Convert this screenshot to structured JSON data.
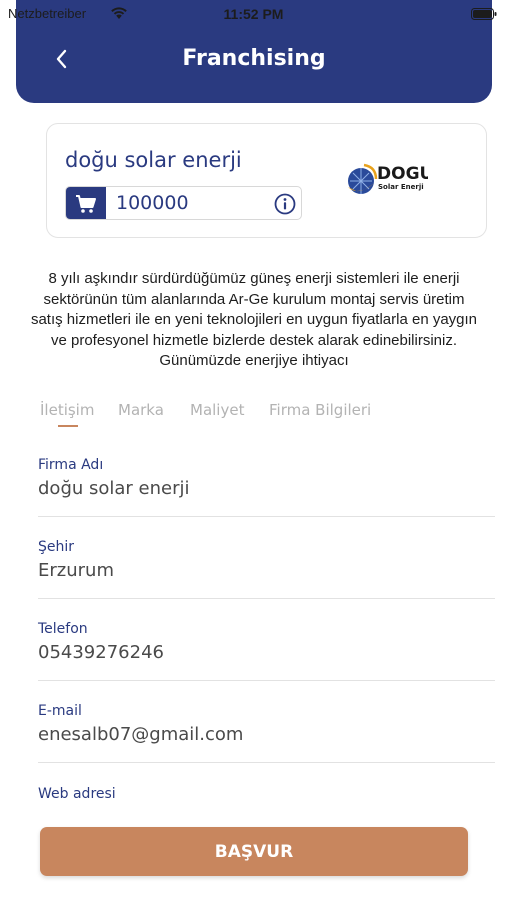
{
  "status_bar": {
    "carrier": "Netzbetreiber",
    "time": "11:52 PM"
  },
  "header": {
    "title": "Franchising",
    "back_icon": "chevron-left-icon",
    "background_color": "#2a3a80"
  },
  "company": {
    "name": "doğu solar enerji",
    "price": "100000",
    "cart_icon": "cart-icon",
    "info_icon": "info-icon",
    "logo": {
      "title": "DOGU",
      "subtitle": "Solar Enerji"
    }
  },
  "description": "8 yılı aşkındır sürdürdüğümüz güneş enerji sistemleri ile enerji sektörünün tüm alanlarında Ar-Ge kurulum montaj servis üretim satış hizmetleri ile en yeni teknolojileri en uygun fiyatlarla en yaygın ve profesyonel hizmetle bizlerde destek alarak edinebilirsiniz. Günümüzde enerjiye ihtiyacı",
  "tabs": [
    {
      "label": "İletişim",
      "active": true
    },
    {
      "label": "Marka",
      "active": false
    },
    {
      "label": "Maliyet",
      "active": false
    },
    {
      "label": "Firma Bilgileri",
      "active": false
    }
  ],
  "form": {
    "fields": [
      {
        "label": "Firma Adı",
        "value": "doğu solar enerji"
      },
      {
        "label": "Şehir",
        "value": "Erzurum"
      },
      {
        "label": "Telefon",
        "value": "05439276246"
      },
      {
        "label": "E-mail",
        "value": "enesalb07@gmail.com"
      },
      {
        "label": "Web adresi",
        "value": ""
      }
    ]
  },
  "apply_button": {
    "label": "BAŞVUR",
    "color": "#c8865e"
  }
}
